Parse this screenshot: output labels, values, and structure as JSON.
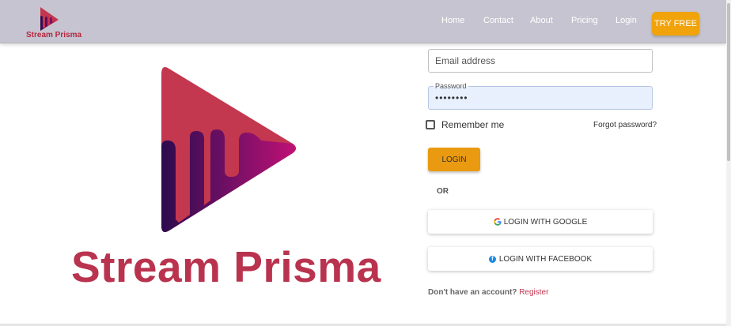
{
  "header": {
    "brand_name": "Stream Prisma",
    "nav": [
      {
        "label": "Home"
      },
      {
        "label": "Contact"
      },
      {
        "label": "About"
      },
      {
        "label": "Pricing"
      },
      {
        "label": "Login"
      }
    ],
    "cta_label": "TRY FREE",
    "colors": {
      "bar": "#c6c4d0",
      "cta": "#f0a30a"
    }
  },
  "hero": {
    "title": "Stream Prisma",
    "logo_icon": "play-triangle-drip-icon",
    "colors": {
      "title": "#b9334f",
      "primary": "#c2374f",
      "accent": "#b4106f",
      "dark": "#2c0b4e"
    }
  },
  "form": {
    "email": {
      "placeholder": "Email address",
      "value": ""
    },
    "password": {
      "label": "Password",
      "value": "••••••••"
    },
    "remember_label": "Remember me",
    "remember_checked": false,
    "forgot_label": "Forgot password?",
    "login_label": "LOGIN",
    "or_label": "OR",
    "google_label": "LOGIN WITH GOOGLE",
    "facebook_label": "LOGIN WITH FACEBOOK",
    "signup_question": "Don't have an account?",
    "signup_link": "Register"
  }
}
